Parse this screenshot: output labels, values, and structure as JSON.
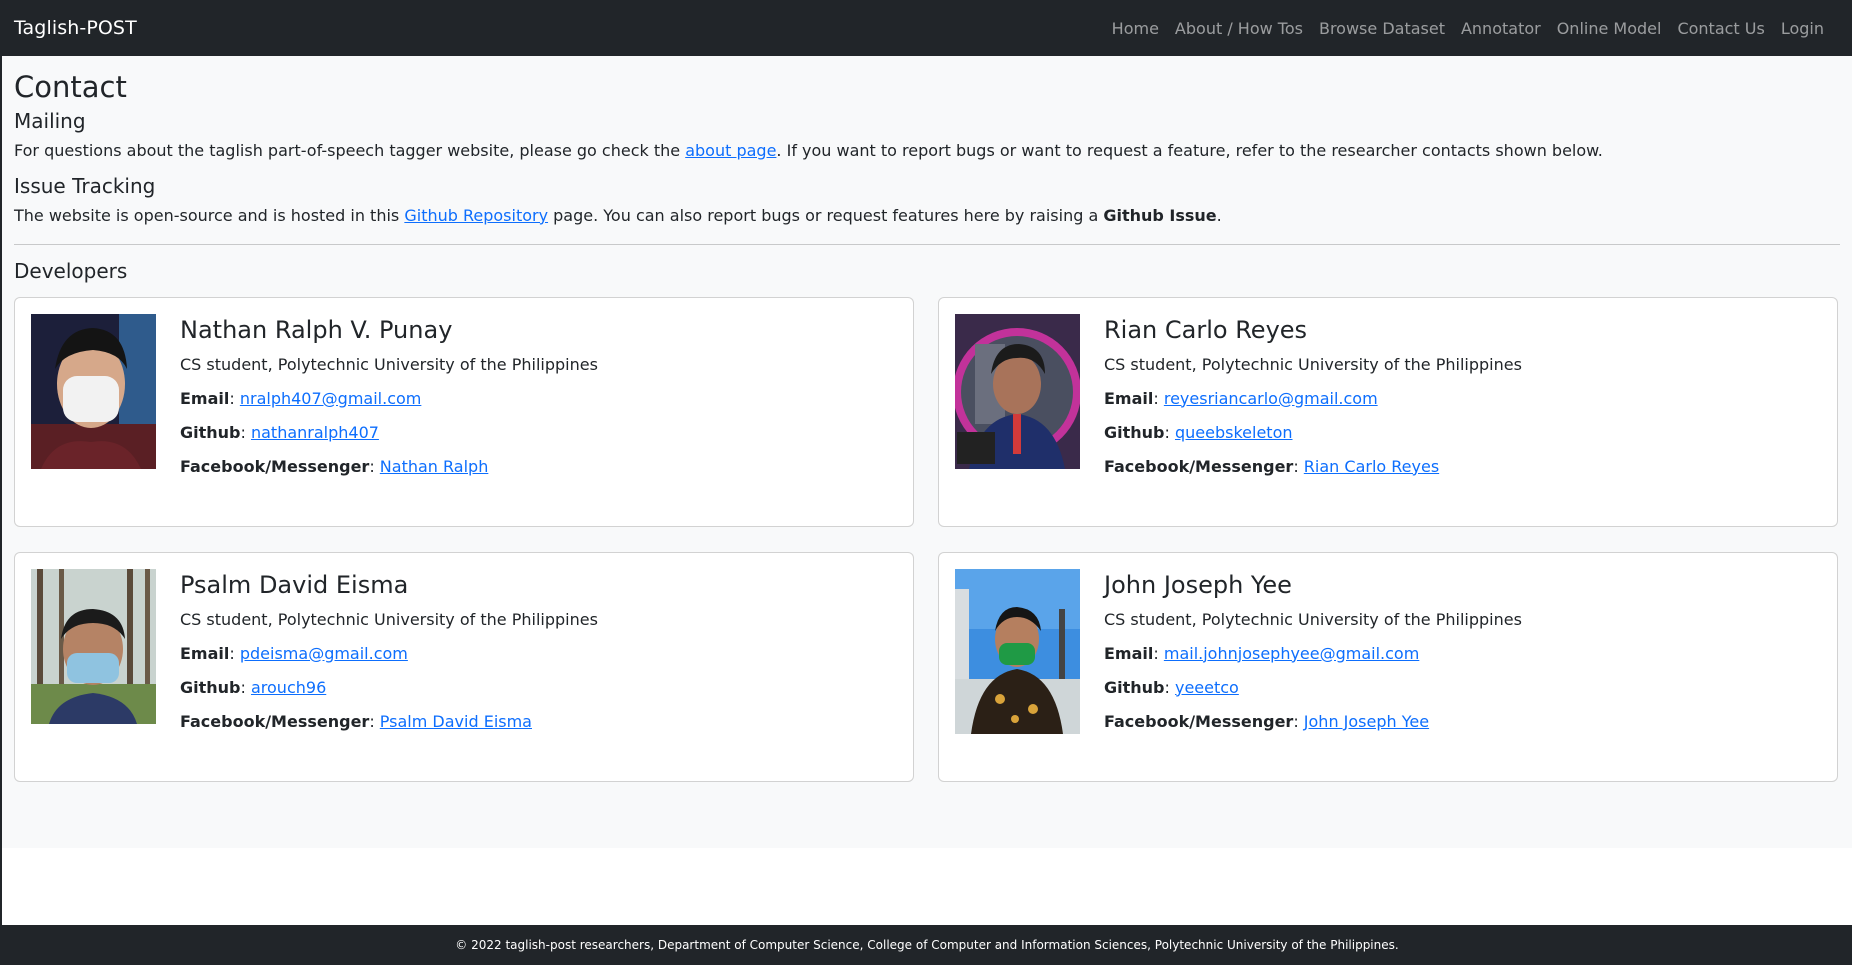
{
  "nav": {
    "brand": "Taglish-POST",
    "links": [
      "Home",
      "About / How Tos",
      "Browse Dataset",
      "Annotator",
      "Online Model",
      "Contact Us",
      "Login"
    ]
  },
  "page": {
    "title": "Contact",
    "mailing": {
      "heading": "Mailing",
      "text_before": "For questions about the taglish part-of-speech tagger website, please go check the ",
      "link": "about page",
      "text_after": ". If you want to report bugs or want to request a feature, refer to the researcher contacts shown below."
    },
    "issues": {
      "heading": "Issue Tracking",
      "text_before": "The website is open-source and is hosted in this ",
      "link": "Github Repository",
      "text_middle": " page. You can also report bugs or request features here by raising a ",
      "bold": "Github Issue",
      "text_after": "."
    },
    "developers_heading": "Developers",
    "labels": {
      "email": "Email",
      "github": "Github",
      "facebook": "Facebook/Messenger",
      "colon": ": "
    },
    "developers": [
      {
        "name": "Nathan Ralph V. Punay",
        "role": "CS student, Polytechnic University of the Philippines",
        "email": "nralph407@gmail.com",
        "github": "nathanralph407",
        "facebook": "Nathan Ralph"
      },
      {
        "name": "Rian Carlo Reyes",
        "role": "CS student, Polytechnic University of the Philippines",
        "email": "reyesriancarlo@gmail.com",
        "github": "queebskeleton",
        "facebook": "Rian Carlo Reyes"
      },
      {
        "name": "Psalm David Eisma",
        "role": "CS student, Polytechnic University of the Philippines",
        "email": "pdeisma@gmail.com",
        "github": "arouch96",
        "facebook": "Psalm David Eisma"
      },
      {
        "name": "John Joseph Yee",
        "role": "CS student, Polytechnic University of the Philippines",
        "email": "mail.johnjosephyee@gmail.com",
        "github": "yeeetco",
        "facebook": "John Joseph Yee"
      }
    ]
  },
  "footer": {
    "text": "© 2022 taglish-post researchers, Department of Computer Science, College of Computer and Information Sciences, Polytechnic University of the Philippines."
  },
  "colors": {
    "navbar": "#212529",
    "link": "#0d6efd",
    "body_bg": "#f8f9fa"
  }
}
